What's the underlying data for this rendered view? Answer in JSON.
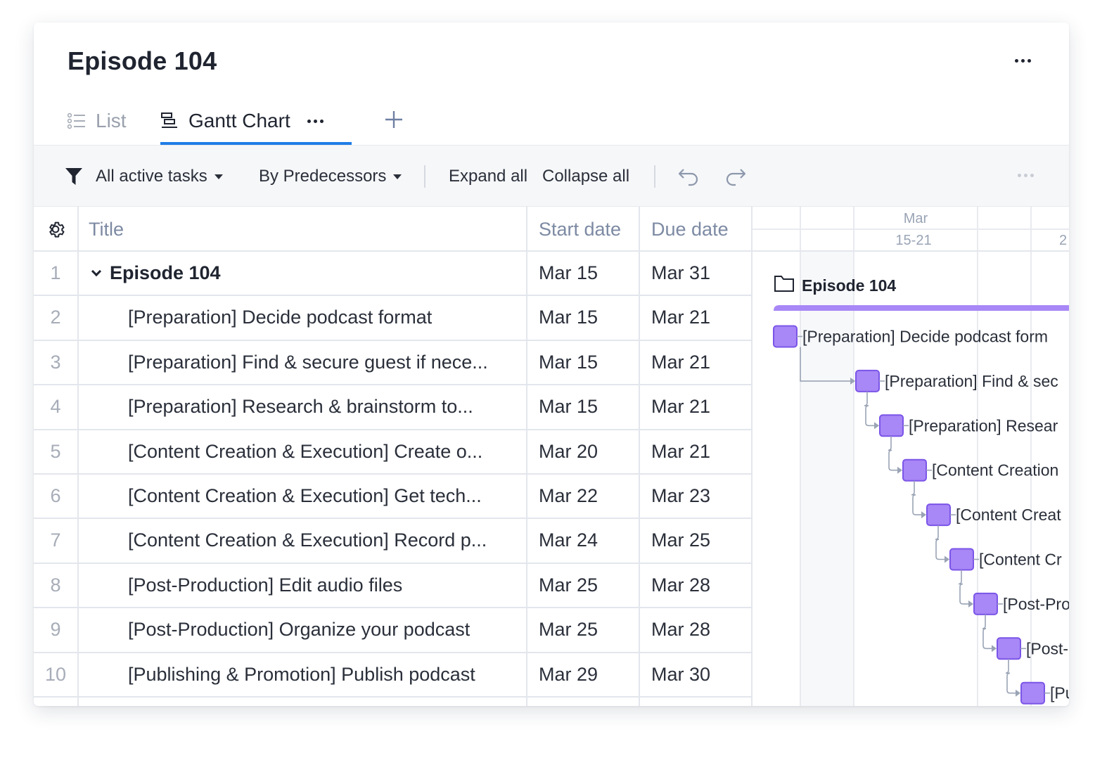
{
  "header": {
    "title": "Episode 104"
  },
  "tabs": [
    {
      "label": "List",
      "icon": "list-icon"
    },
    {
      "label": "Gantt Chart",
      "icon": "gantt-icon",
      "active": true
    }
  ],
  "toolbar": {
    "filter_label": "All active tasks",
    "group_label": "By Predecessors",
    "expand_label": "Expand all",
    "collapse_label": "Collapse all"
  },
  "grid": {
    "columns": {
      "title": "Title",
      "start": "Start date",
      "due": "Due date"
    },
    "rows": [
      {
        "num": "1",
        "title": "Episode 104",
        "start": "Mar 15",
        "due": "Mar 31",
        "parent": true
      },
      {
        "num": "2",
        "title": "[Preparation] Decide podcast format",
        "start": "Mar 15",
        "due": "Mar 21"
      },
      {
        "num": "3",
        "title": "[Preparation] Find & secure guest if nece...",
        "start": "Mar 15",
        "due": "Mar 21"
      },
      {
        "num": "4",
        "title": "[Preparation] Research & brainstorm to...",
        "start": "Mar 15",
        "due": "Mar 21"
      },
      {
        "num": "5",
        "title": "[Content Creation & Execution] Create o...",
        "start": "Mar 20",
        "due": "Mar 21"
      },
      {
        "num": "6",
        "title": "[Content Creation & Execution] Get tech...",
        "start": "Mar 22",
        "due": "Mar 23"
      },
      {
        "num": "7",
        "title": "[Content Creation & Execution] Record p...",
        "start": "Mar 24",
        "due": "Mar 25"
      },
      {
        "num": "8",
        "title": "[Post-Production] Edit audio files",
        "start": "Mar 25",
        "due": "Mar 28"
      },
      {
        "num": "9",
        "title": "[Post-Production] Organize your podcast",
        "start": "Mar 25",
        "due": "Mar 28"
      },
      {
        "num": "10",
        "title": "[Publishing & Promotion] Publish podcast",
        "start": "Mar 29",
        "due": "Mar 30"
      }
    ]
  },
  "gantt": {
    "month": "Mar",
    "weeks": [
      "15-21",
      "2"
    ],
    "project_label": "Episode 104",
    "bar_labels": [
      "[Preparation] Decide podcast form",
      "[Preparation] Find & sec",
      "[Preparation] Resear",
      "[Content Creation",
      "[Content Creat",
      "[Content Cr",
      "[Post-Pro",
      "[Post-",
      "[Pu"
    ]
  },
  "colors": {
    "accent": "#1f7ee6",
    "bar_fill": "#a887f6",
    "bar_stroke": "#7b55e8",
    "connector": "#9aa4b5"
  }
}
